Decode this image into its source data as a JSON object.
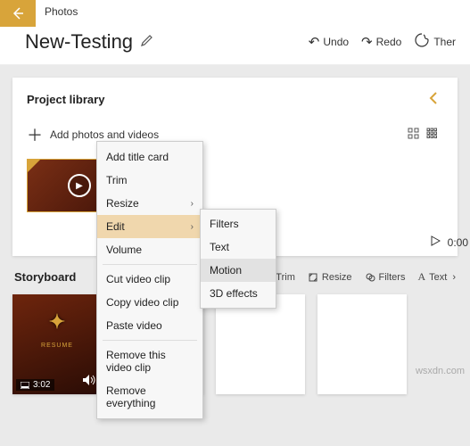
{
  "titlebar": {
    "app": "Photos"
  },
  "header": {
    "title": "New-Testing",
    "undo": "Undo",
    "redo": "Redo",
    "theme": "Ther"
  },
  "library": {
    "title": "Project library",
    "add": "Add photos and videos"
  },
  "preview": {
    "time": "0:00"
  },
  "storyboard": {
    "title": "Storyboard",
    "tools": {
      "trim": "Trim",
      "resize": "Resize",
      "filters": "Filters",
      "text": "Text"
    },
    "clip": {
      "duration": "3:02",
      "label": "RESUME"
    }
  },
  "context_menu": {
    "add_title_card": "Add title card",
    "trim": "Trim",
    "resize": "Resize",
    "edit": "Edit",
    "volume": "Volume",
    "cut": "Cut video clip",
    "copy": "Copy video clip",
    "paste": "Paste video",
    "remove_clip": "Remove this video clip",
    "remove_all": "Remove everything"
  },
  "submenu": {
    "filters": "Filters",
    "text": "Text",
    "motion": "Motion",
    "effects": "3D effects"
  },
  "watermark": "wsxdn.com"
}
